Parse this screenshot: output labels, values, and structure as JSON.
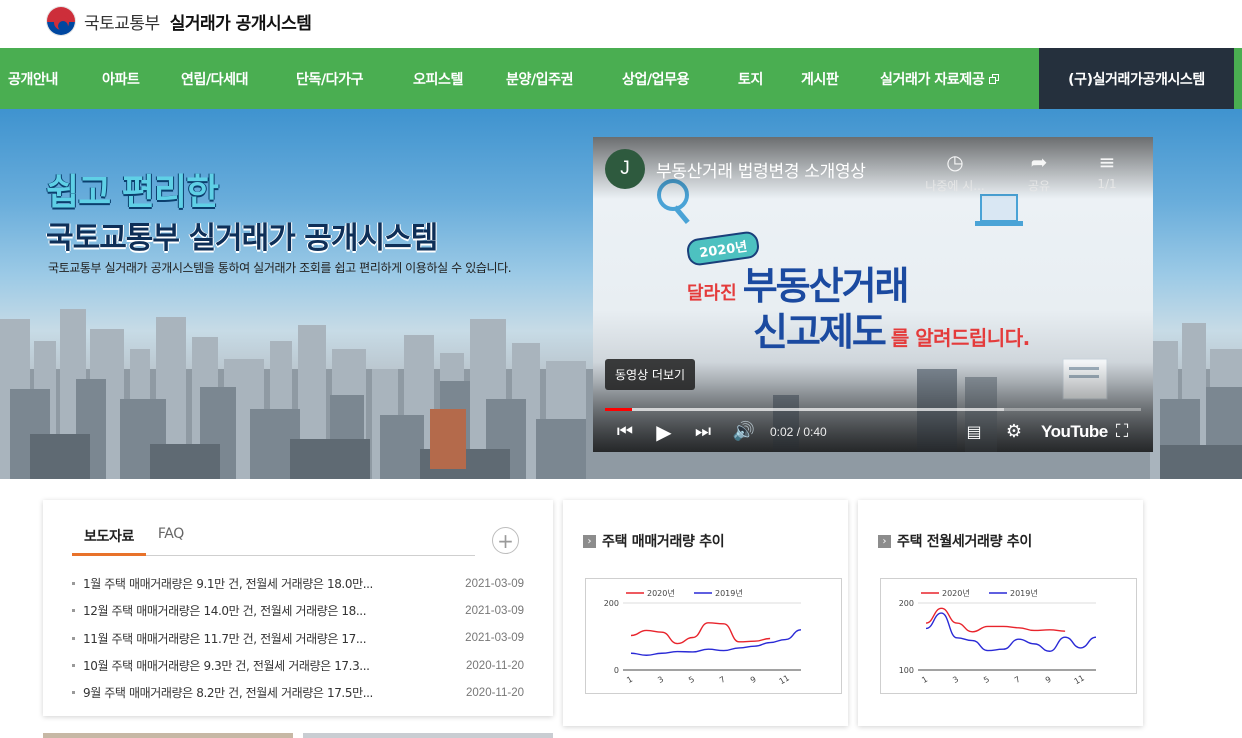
{
  "header": {
    "ministry": "국토교통부",
    "system": "실거래가 공개시스템"
  },
  "nav": {
    "items": [
      "공개안내",
      "아파트",
      "연립/다세대",
      "단독/다가구",
      "오피스텔",
      "분양/입주권",
      "상업/업무용",
      "토지",
      "게시판",
      "실거래가 자료제공"
    ],
    "old_system": "(구)실거래가공개시스템",
    "colors": {
      "nav_bg": "#4aae51",
      "old_bg": "#25303d"
    }
  },
  "hero": {
    "title1": "쉽고 편리한",
    "title2": "국토교통부 실거래가 공개시스템",
    "desc": "국토교통부 실거래가 공개시스템을 통하여 실거래가 조회를 쉽고 편리하게 이용하실 수 있습니다."
  },
  "video": {
    "channel_initial": "J",
    "title": "부동산거래 법령변경 소개영상",
    "watch_later": "나중에 시...",
    "share": "공유",
    "playlist": "1/1",
    "promo_year": "2020년",
    "promo_changed": "달라진",
    "promo_big1": "부동산거래",
    "promo_big2": "신고제도",
    "promo_tail": "를 알려드립니다.",
    "more": "동영상 더보기",
    "time": "0:02 / 0:40",
    "played_fraction": 0.05,
    "buffered_fraction": 0.745,
    "youtube": "YouTube"
  },
  "news": {
    "tabs": [
      "보도자료",
      "FAQ"
    ],
    "items": [
      {
        "title": "1월 주택 매매거래량은 9.1만 건, 전월세 거래량은 18.0만...",
        "date": "2021-03-09"
      },
      {
        "title": "12월 주택 매매거래량은 14.0만 건, 전월세 거래량은 18...",
        "date": "2021-03-09"
      },
      {
        "title": "11월 주택 매매거래량은 11.7만 건, 전월세 거래량은 17...",
        "date": "2021-03-09"
      },
      {
        "title": "10월 주택 매매거래량은 9.3만 건, 전월세 거래량은 17.3...",
        "date": "2020-11-20"
      },
      {
        "title": "9월 주택 매매거래량은 8.2만 건, 전월세 거래량은 17.5만...",
        "date": "2020-11-20"
      }
    ]
  },
  "charts": {
    "sale_title": "주택 매매거래량 추이",
    "rent_title": "주택 전월세거래량 추이"
  },
  "chart_data": [
    {
      "type": "line",
      "title": "주택 매매거래량 추이",
      "x": [
        1,
        2,
        3,
        4,
        5,
        6,
        7,
        8,
        9,
        10,
        11,
        12
      ],
      "x_tick_labels": [
        "1",
        "3",
        "5",
        "7",
        "9",
        "11"
      ],
      "ylim": [
        0,
        200
      ],
      "y_ticks": [
        0,
        200
      ],
      "series": [
        {
          "name": "2020년",
          "color": "#e8242c",
          "values": [
            103,
            118,
            113,
            79,
            97,
            141,
            138,
            84,
            86,
            94
          ]
        },
        {
          "name": "2019년",
          "color": "#2a2ad6",
          "values": [
            50,
            44,
            50,
            55,
            54,
            62,
            58,
            66,
            71,
            82,
            91,
            120
          ]
        }
      ],
      "legend": "top-left",
      "grid": true
    },
    {
      "type": "line",
      "title": "주택 전월세거래량 추이",
      "x": [
        1,
        2,
        3,
        4,
        5,
        6,
        7,
        8,
        9,
        10,
        11,
        12
      ],
      "x_tick_labels": [
        "1",
        "3",
        "5",
        "7",
        "9",
        "11"
      ],
      "ylim": [
        100,
        200
      ],
      "y_ticks": [
        100,
        200
      ],
      "series": [
        {
          "name": "2020년",
          "color": "#e8242c",
          "values": [
            170,
            192,
            170,
            157,
            165,
            165,
            163,
            159,
            160,
            158
          ]
        },
        {
          "name": "2019년",
          "color": "#2a2ad6",
          "values": [
            162,
            185,
            148,
            144,
            129,
            131,
            146,
            139,
            128,
            149,
            133,
            149
          ]
        }
      ],
      "legend": "top-left",
      "grid": true
    }
  ]
}
